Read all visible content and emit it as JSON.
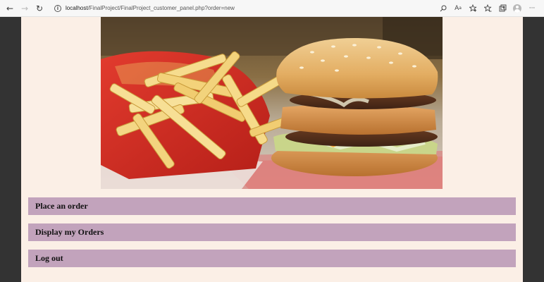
{
  "browser": {
    "url_host": "localhost",
    "url_path": "/FinalProject/FinalProject_customer_panel.php?order=new",
    "icons": [
      "back-icon",
      "forward-icon",
      "refresh-icon",
      "info-icon",
      "search-icon",
      "read-aloud-icon",
      "favorite-add-icon",
      "favorites-icon",
      "collections-icon",
      "profile-icon",
      "more-icon"
    ]
  },
  "hero": {
    "image": "burger-and-fries-photo"
  },
  "menu": {
    "items": [
      {
        "label": "Place an order"
      },
      {
        "label": "Display my Orders"
      },
      {
        "label": "Log out"
      }
    ]
  },
  "colors": {
    "page_bg": "#fbefe6",
    "side_bg": "#333333",
    "menu_bar": "#c2a3bc"
  }
}
